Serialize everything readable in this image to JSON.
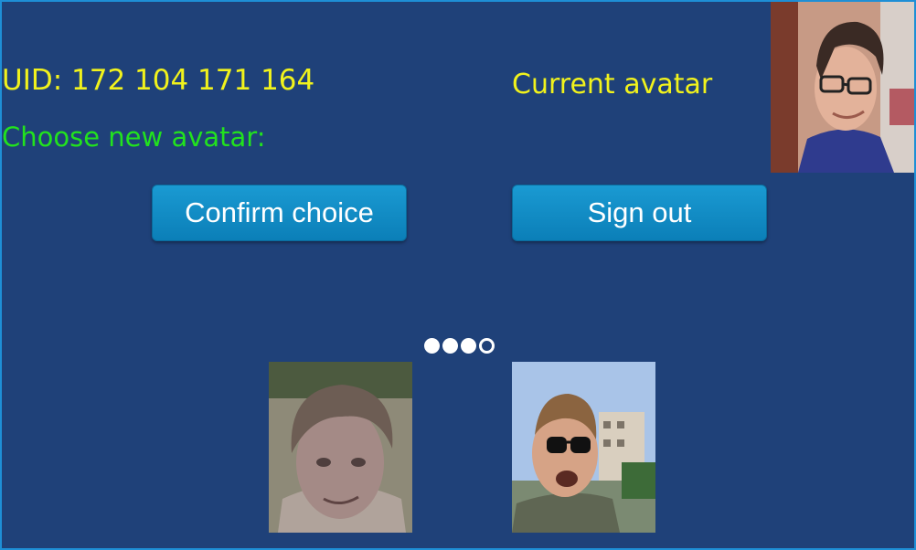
{
  "profile": {
    "uid_text": "UID: 172 104 171 164",
    "choose_text": "Choose new avatar:",
    "current_avatar_label": "Current avatar"
  },
  "buttons": {
    "confirm_label": "Confirm choice",
    "signout_label": "Sign out"
  },
  "carousel": {
    "page_count": 4,
    "active_page": 4
  },
  "avatars": {
    "current": "photo-young-man-glasses",
    "options": [
      "photo-grainy-young-man",
      "photo-man-sunglasses-selfie"
    ]
  },
  "colors": {
    "background": "#1f4179",
    "border": "#1e8fd6",
    "uid_text": "#f1f21c",
    "choose_text": "#22e21e",
    "button": "#1a9ad2"
  }
}
